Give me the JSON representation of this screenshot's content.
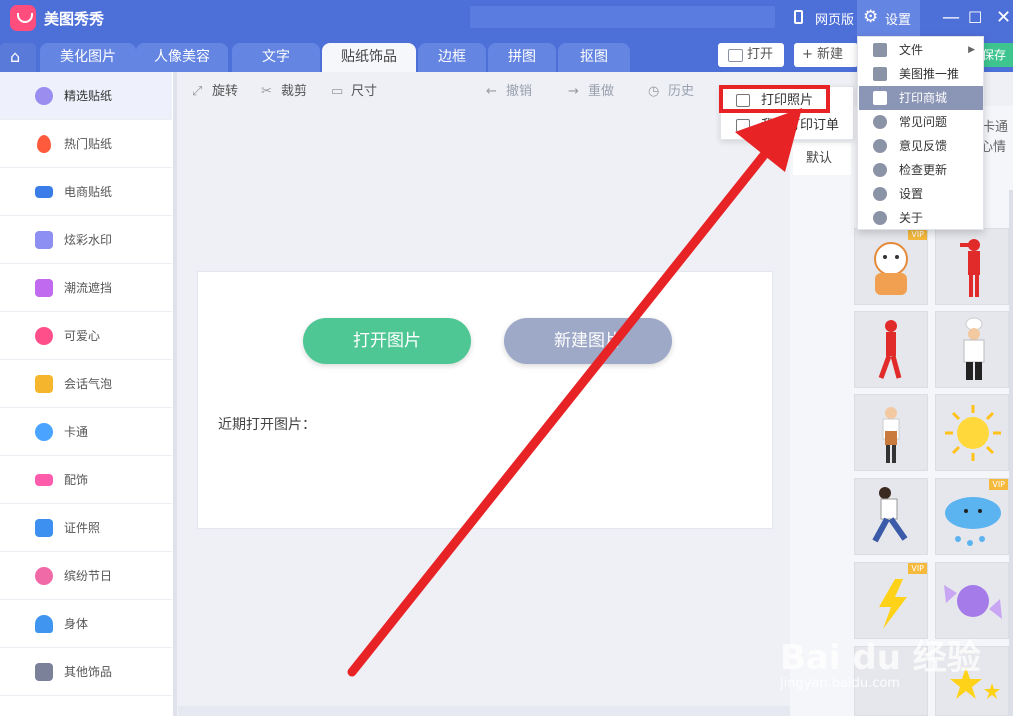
{
  "titlebar": {
    "app_name": "美图秀秀",
    "web_version": "网页版",
    "settings": "设置"
  },
  "tabs": [
    {
      "label": "美化图片"
    },
    {
      "label": "人像美容"
    },
    {
      "label": "文字"
    },
    {
      "label": "贴纸饰品"
    },
    {
      "label": "边框"
    },
    {
      "label": "拼图"
    },
    {
      "label": "抠图"
    }
  ],
  "actions": {
    "open": "打开",
    "new": "+ 新建",
    "save": "保存"
  },
  "sidebar": {
    "items": [
      {
        "label": "精选贴纸",
        "color": "#9b8cf0"
      },
      {
        "label": "热门贴纸",
        "color": "#ff5a3c"
      },
      {
        "label": "电商贴纸",
        "color": "#3b7de8"
      },
      {
        "label": "炫彩水印",
        "color": "#8d8ff2"
      },
      {
        "label": "潮流遮挡",
        "color": "#c06af0"
      },
      {
        "label": "可爱心",
        "color": "#ff4f8a"
      },
      {
        "label": "会话气泡",
        "color": "#f5b62e"
      },
      {
        "label": "卡通",
        "color": "#4aa3ff"
      },
      {
        "label": "配饰",
        "color": "#ff5cab"
      },
      {
        "label": "证件照",
        "color": "#3d8ff0"
      },
      {
        "label": "缤纷节日",
        "color": "#f06aa8"
      },
      {
        "label": "身体",
        "color": "#3f95f0"
      },
      {
        "label": "其他饰品",
        "color": "#7b8199"
      }
    ]
  },
  "toolbar": {
    "rotate": "旋转",
    "crop": "裁剪",
    "size": "尺寸",
    "undo": "撤销",
    "redo": "重做",
    "history": "历史"
  },
  "welcome": {
    "open_image": "打开图片",
    "new_image": "新建图片",
    "recent": "近期打开图片："
  },
  "right_panel": {
    "tab_default": "默认",
    "partial_a": "卡通",
    "partial_b": "心情",
    "vip": "VIP"
  },
  "print_menu": {
    "print_photo": "打印照片",
    "my_orders": "我的打印订单"
  },
  "settings_menu": {
    "items": [
      {
        "label": "文件",
        "has_sub": true
      },
      {
        "label": "美图推一推"
      },
      {
        "label": "打印商城",
        "highlighted": true
      },
      {
        "label": "常见问题"
      },
      {
        "label": "意见反馈"
      },
      {
        "label": "检查更新"
      },
      {
        "label": "设置"
      },
      {
        "label": "关于"
      }
    ]
  },
  "watermark": {
    "brand": "Bai du 经验",
    "url": "jingyan.baidu.com"
  },
  "colors": {
    "primary": "#4d6fd8",
    "accent_green": "#4fc795",
    "highlight_red": "#e82326"
  }
}
